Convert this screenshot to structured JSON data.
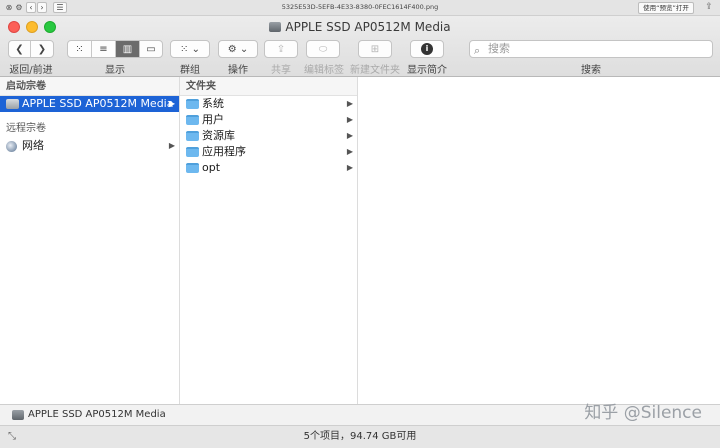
{
  "outer": {
    "title": "5325E53D-5EFB-4E33-8380-0FEC1614F400.png",
    "open_button": "使用“预览”打开"
  },
  "window": {
    "title": "APPLE SSD AP0512M Media"
  },
  "toolbar": {
    "nav_label": "返回/前进",
    "view_label": "显示",
    "group_label": "群组",
    "action_label": "操作",
    "share_label": "共享",
    "tags_label": "编辑标签",
    "newfolder_label": "新建文件夹",
    "info_label": "显示简介",
    "search_placeholder": "搜索",
    "search_label": "搜索"
  },
  "sidebar": {
    "startup_header": "启动宗卷",
    "startup_items": [
      {
        "label": "APPLE SSD AP0512M Media",
        "icon": "disk-icon",
        "selected": true
      }
    ],
    "remote_header": "远程宗卷",
    "remote_items": [
      {
        "label": "网络",
        "icon": "globe-icon"
      }
    ]
  },
  "folders_column": {
    "header": "文件夹",
    "items": [
      {
        "label": "系统",
        "icon": "folder-icon",
        "has_children": true
      },
      {
        "label": "用户",
        "icon": "folder-icon",
        "has_children": true
      },
      {
        "label": "资源库",
        "icon": "folder-icon",
        "has_children": true
      },
      {
        "label": "应用程序",
        "icon": "folder-icon",
        "has_children": true
      },
      {
        "label": "opt",
        "icon": "folder-icon",
        "has_children": true
      }
    ]
  },
  "pathbar": {
    "disk": "APPLE SSD AP0512M Media",
    "watermark": "知乎 @Silence"
  },
  "statusbar": {
    "text": "5个项目，94.74 GB可用"
  },
  "colors": {
    "selection": "#1d63d6",
    "folder": "#6db8ef",
    "close": "#fc5f57",
    "minimize": "#fdbc2e",
    "zoom": "#28c840"
  }
}
